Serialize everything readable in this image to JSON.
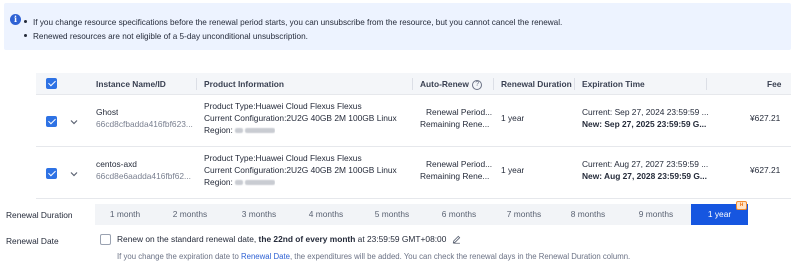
{
  "notice": {
    "lines": [
      "If you change resource specifications before the renewal period starts, you can unsubscribe from the resource, but you cannot cancel the renewal.",
      "Renewed resources are not eligible of a 5-day unconditional unsubscription."
    ]
  },
  "table": {
    "headers": {
      "instance": "Instance Name/ID",
      "product": "Product Information",
      "auto_renew": "Auto-Renew",
      "duration": "Renewal Duration",
      "expiration": "Expiration Time",
      "fee": "Fee"
    },
    "rows": [
      {
        "name": "Ghost",
        "id": "66cd8cfbadda416fbf623...",
        "product_type": "Product Type:Huawei Cloud Flexus Flexus",
        "configuration": "Current Configuration:2U2G 40GB 2M 100GB Linux",
        "region_label": "Region:",
        "auto_renew_line1": "Renewal Period...",
        "auto_renew_line2": "Remaining Rene...",
        "duration": "1 year",
        "current": "Current: Sep 27, 2024 23:59:59 ...",
        "new": "New: Sep 27, 2025 23:59:59 G...",
        "fee": "¥627.21"
      },
      {
        "name": "centos-axd",
        "id": "66cd8e6aadda416fbf62...",
        "product_type": "Product Type:Huawei Cloud Flexus Flexus",
        "configuration": "Current Configuration:2U2G 40GB 2M 100GB Linux",
        "region_label": "Region:",
        "auto_renew_line1": "Renewal Period...",
        "auto_renew_line2": "Remaining Rene...",
        "duration": "1 year",
        "current": "Current: Aug 27, 2027 23:59:59 ...",
        "new": "New: Aug 27, 2028 23:59:59 G...",
        "fee": "¥627.21"
      }
    ]
  },
  "renewal_duration": {
    "label": "Renewal Duration",
    "options": [
      "1 month",
      "2 months",
      "3 months",
      "4 months",
      "5 months",
      "6 months",
      "7 months",
      "8 months",
      "9 months",
      "1 year"
    ],
    "selected": "1 year"
  },
  "renewal_date": {
    "label": "Renewal Date",
    "text_before": "Renew on the standard renewal date, ",
    "text_bold": "the 22nd of every month",
    "text_after": " at 23:59:59 GMT+08:00",
    "hint_before": "If you change the expiration date to ",
    "hint_link": "Renewal Date",
    "hint_after": ", the expenditures will be added. You can check the renewal days in the Renewal Duration column."
  },
  "colors": {
    "accent": "#1656e0",
    "notice_bg": "#edf3ff",
    "checkbox": "#2e72e4"
  }
}
